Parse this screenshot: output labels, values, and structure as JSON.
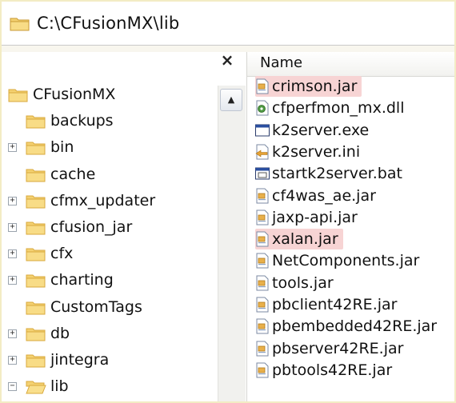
{
  "address": {
    "path": "C:\\CFusionMX\\lib"
  },
  "left_pane": {
    "close_label": "×",
    "scroll_up_label": "▲",
    "tree": [
      {
        "label": "CFusionMX",
        "expander": null,
        "level": 0
      },
      {
        "label": "backups",
        "expander": null,
        "level": 1
      },
      {
        "label": "bin",
        "expander": "+",
        "level": 1
      },
      {
        "label": "cache",
        "expander": null,
        "level": 1
      },
      {
        "label": "cfmx_updater",
        "expander": "+",
        "level": 1
      },
      {
        "label": "cfusion_jar",
        "expander": "+",
        "level": 1
      },
      {
        "label": "cfx",
        "expander": "+",
        "level": 1
      },
      {
        "label": "charting",
        "expander": "+",
        "level": 1
      },
      {
        "label": "CustomTags",
        "expander": null,
        "level": 1
      },
      {
        "label": "db",
        "expander": "+",
        "level": 1
      },
      {
        "label": "jintegra",
        "expander": "+",
        "level": 1
      },
      {
        "label": "lib",
        "expander": "−",
        "level": 1,
        "open": true
      }
    ]
  },
  "right_pane": {
    "column_name": "Name",
    "files": [
      {
        "label": "crimson.jar",
        "icon": "jar-icon",
        "highlighted": true
      },
      {
        "label": "cfperfmon_mx.dll",
        "icon": "dll-icon",
        "highlighted": false
      },
      {
        "label": "k2server.exe",
        "icon": "exe-icon",
        "highlighted": false
      },
      {
        "label": "k2server.ini",
        "icon": "ini-icon",
        "highlighted": false
      },
      {
        "label": "startk2server.bat",
        "icon": "bat-icon",
        "highlighted": false
      },
      {
        "label": "cf4was_ae.jar",
        "icon": "jar-icon",
        "highlighted": false
      },
      {
        "label": "jaxp-api.jar",
        "icon": "jar-icon",
        "highlighted": false
      },
      {
        "label": "xalan.jar",
        "icon": "jar-icon",
        "highlighted": true
      },
      {
        "label": "NetComponents.jar",
        "icon": "jar-icon",
        "highlighted": false
      },
      {
        "label": "tools.jar",
        "icon": "jar-icon",
        "highlighted": false
      },
      {
        "label": "pbclient42RE.jar",
        "icon": "jar-icon",
        "highlighted": false
      },
      {
        "label": "pbembedded42RE.jar",
        "icon": "jar-icon",
        "highlighted": false
      },
      {
        "label": "pbserver42RE.jar",
        "icon": "jar-icon",
        "highlighted": false
      },
      {
        "label": "pbtools42RE.jar",
        "icon": "jar-icon",
        "highlighted": false
      }
    ]
  },
  "colors": {
    "folder": "#f4d171",
    "folder_dark": "#d9a93d",
    "highlight": "#f7d4d4",
    "frame_border": "#f3ecc4"
  }
}
